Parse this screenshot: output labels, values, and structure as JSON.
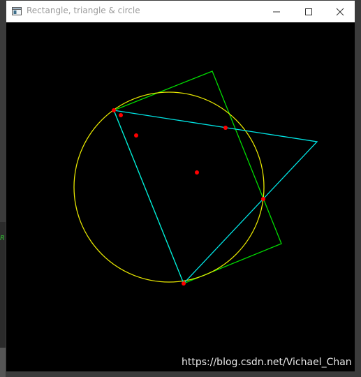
{
  "window": {
    "title": "Rectangle, triangle & circle"
  },
  "titlebar_buttons": {
    "minimize_icon": "minimize-icon",
    "maximize_icon": "maximize-icon",
    "close_icon": "close-icon"
  },
  "background": {
    "left_label": "R"
  },
  "watermark": {
    "text": "https://blog.csdn.net/Vichael_Chan"
  },
  "colors": {
    "canvas": "#000000",
    "rectangle": "#00ff00",
    "triangle": "#00ffff",
    "circle": "#ffff00",
    "points": "#ff0000"
  }
}
